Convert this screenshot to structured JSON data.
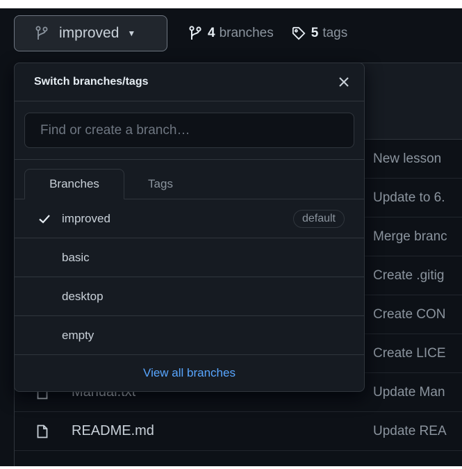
{
  "branch_selector": {
    "current": "improved"
  },
  "meta": {
    "branches_count": "4",
    "branches_label": "branches",
    "tags_count": "5",
    "tags_label": "tags"
  },
  "dropdown": {
    "title": "Switch branches/tags",
    "search_placeholder": "Find or create a branch…",
    "tabs": [
      {
        "label": "Branches",
        "active": true
      },
      {
        "label": "Tags",
        "active": false
      }
    ],
    "branches": [
      {
        "name": "improved",
        "selected": true,
        "badge": "default"
      },
      {
        "name": "basic"
      },
      {
        "name": "desktop"
      },
      {
        "name": "empty"
      }
    ],
    "footer_link": "View all branches"
  },
  "files": [
    {
      "name": "",
      "commit": "New lesson"
    },
    {
      "name": "",
      "commit": "Update to 6."
    },
    {
      "name": "",
      "commit": "Merge branc"
    },
    {
      "name": "",
      "commit": "Create .gitig"
    },
    {
      "name": "",
      "commit": "Create CON"
    },
    {
      "name": "",
      "commit": "Create LICE"
    },
    {
      "name": "Manual.txt",
      "commit": "Update Man"
    },
    {
      "name": "README.md",
      "commit": "Update REA"
    }
  ],
  "colors": {
    "background": "#0d1117",
    "panel": "#161b22",
    "border": "#30363d",
    "link": "#58a6ff",
    "text": "#c9d1d9",
    "muted": "#8b949e"
  }
}
